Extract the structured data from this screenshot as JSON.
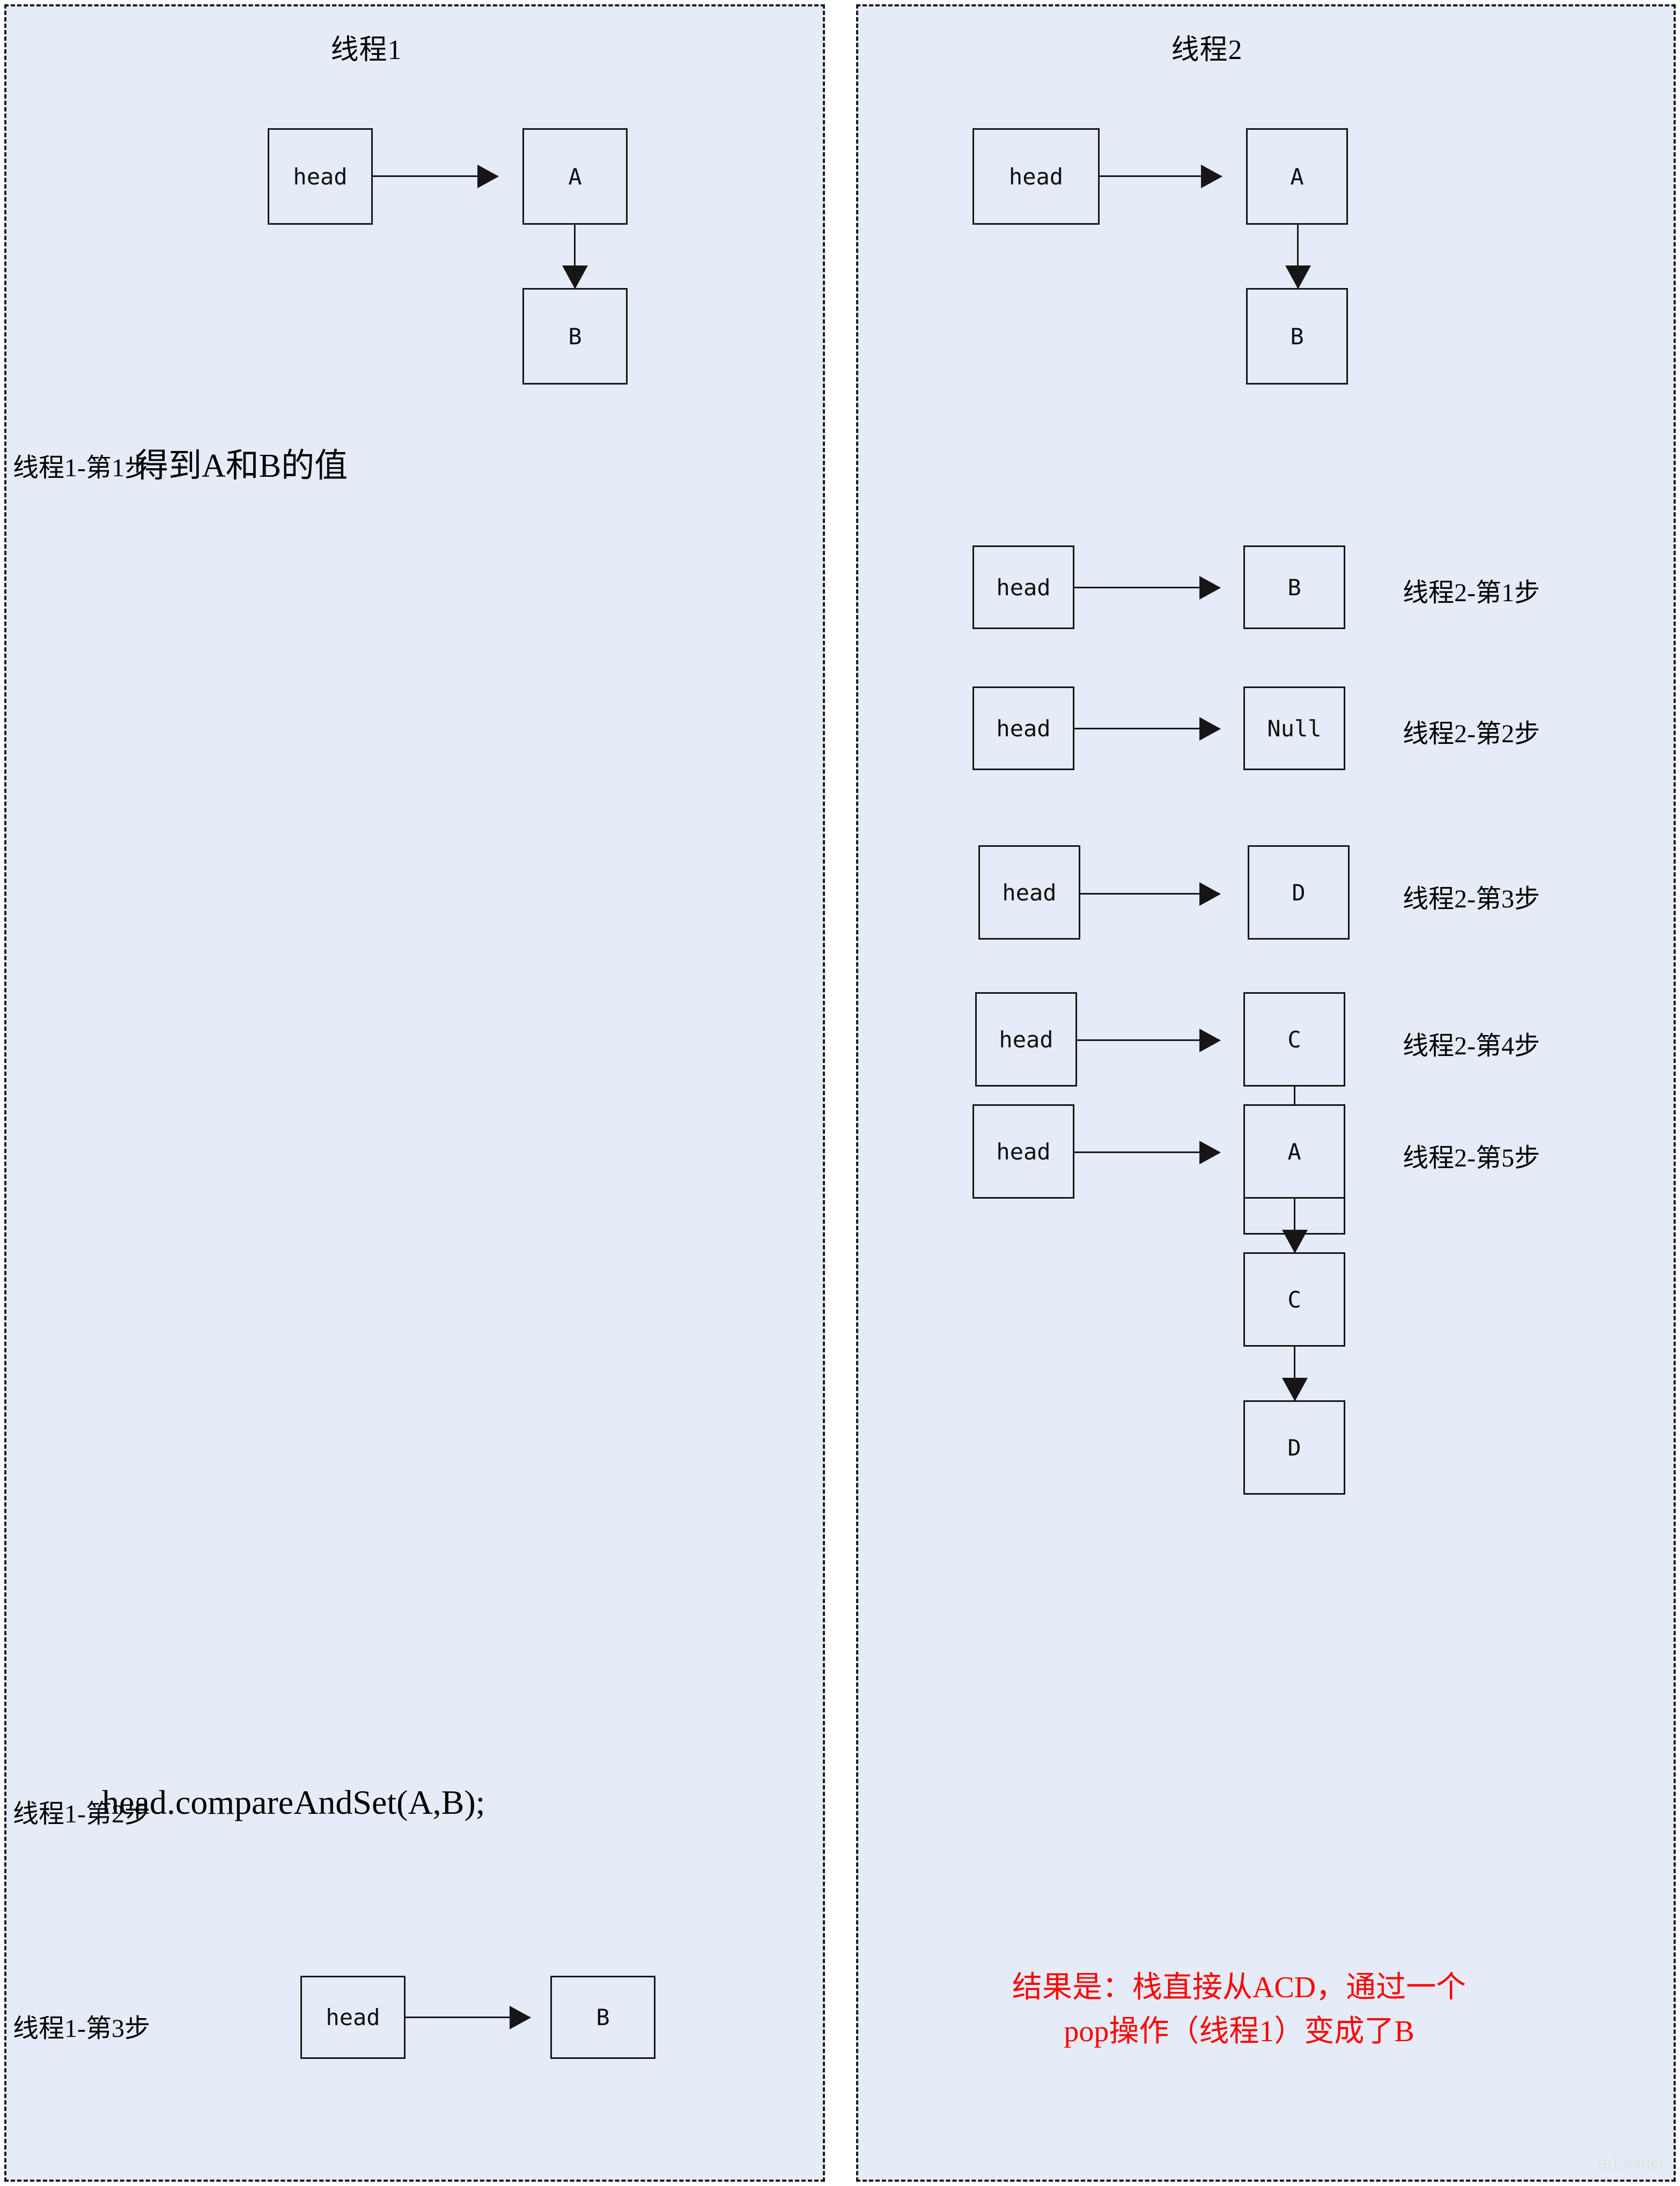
{
  "panels": {
    "thread1": {
      "title": "线程1",
      "diagram_top": {
        "head_label": "head",
        "node_a": "A",
        "node_b": "B"
      },
      "step1": {
        "label": "线程1-第1步",
        "caption": "得到A和B的值"
      },
      "step2": {
        "label": "线程1-第2步",
        "code": "head.compareAndSet(A,B);"
      },
      "step3": {
        "label": "线程1-第3步",
        "head_label": "head",
        "node": "B"
      }
    },
    "thread2": {
      "title": "线程2",
      "diagram_top": {
        "head_label": "head",
        "node_a": "A",
        "node_b": "B"
      },
      "steps": [
        {
          "label": "线程2-第1步",
          "head_label": "head",
          "chain": [
            "B"
          ]
        },
        {
          "label": "线程2-第2步",
          "head_label": "head",
          "chain": [
            "Null"
          ]
        },
        {
          "label": "线程2-第3步",
          "head_label": "head",
          "chain": [
            "D"
          ]
        },
        {
          "label": "线程2-第4步",
          "head_label": "head",
          "chain": [
            "C",
            "D"
          ]
        },
        {
          "label": "线程2-第5步",
          "head_label": "head",
          "chain": [
            "A",
            "C",
            "D"
          ]
        }
      ],
      "result_note_line1": "结果是：栈直接从ACD，通过一个",
      "result_note_line2": "pop操作（线程1）变成了B"
    }
  },
  "watermark": "mLeader",
  "colors": {
    "panel_background": "#e5ecf7",
    "page_background": "#ffffff",
    "border": "#161616",
    "note_red": "#fe0000"
  }
}
